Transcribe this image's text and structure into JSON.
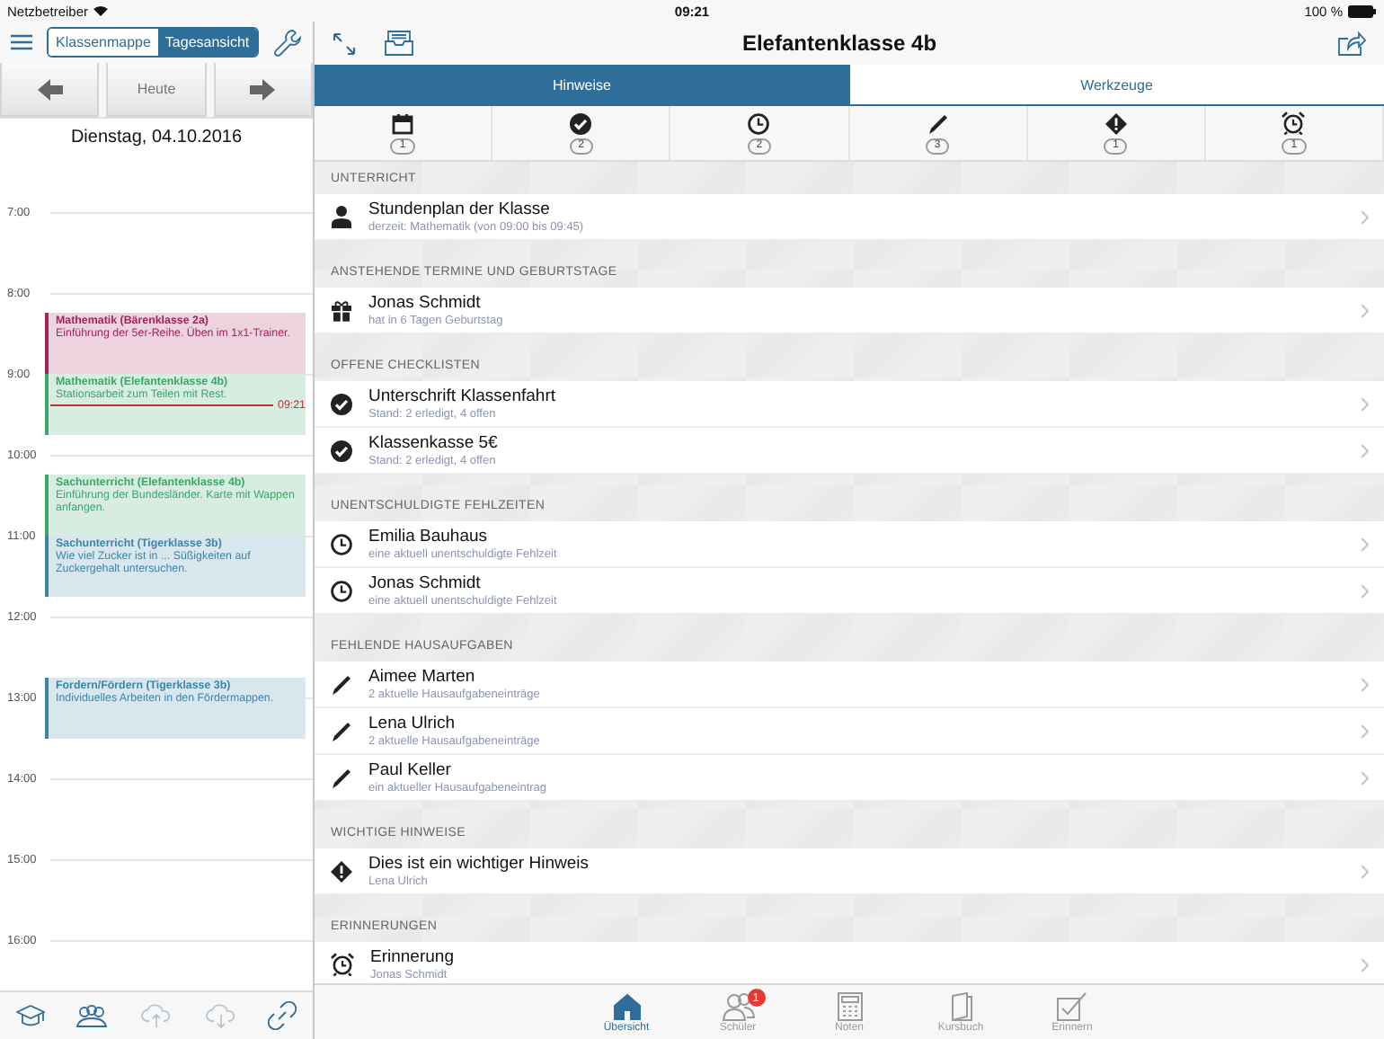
{
  "status_bar": {
    "carrier": "Netzbetreiber",
    "time": "09:21",
    "battery": "100 %"
  },
  "sidebar": {
    "segments": [
      {
        "label": "Klassenmappe",
        "selected": false
      },
      {
        "label": "Tagesansicht",
        "selected": true
      }
    ],
    "today_button": "Heute",
    "date": "Dienstag, 04.10.2016",
    "hours": [
      "7:00",
      "8:00",
      "9:00",
      "10:00",
      "11:00",
      "12:00",
      "13:00",
      "14:00",
      "15:00",
      "16:00"
    ],
    "now": "09:21",
    "events": [
      {
        "title": "Mathematik (Bärenklasse 2a)",
        "text": "Einführung der 5er-Reihe. Üben im 1x1-Trainer.",
        "color": "#a3245a"
      },
      {
        "title": "Mathematik (Elefantenklasse 4b)",
        "text": "Stationsarbeit zum Teilen mit Rest.",
        "color": "#3aa66a"
      },
      {
        "title": "Sachunterricht (Elefantenklasse 4b)",
        "text": "Einführung der Bundesländer. Karte mit Wappen anfangen.",
        "color": "#3aa66a"
      },
      {
        "title": "Sachunterricht (Tigerklasse 3b)",
        "text": "Wie viel Zucker ist in ... Süßigkeiten auf Zuckergehalt untersuchen.",
        "color": "#3a86a8"
      },
      {
        "title": "Fordern/Fördern (Tigerklasse 3b)",
        "text": "Individuelles Arbeiten in den Fördermappen.",
        "color": "#3a86a8"
      }
    ]
  },
  "header": {
    "title": "Elefantenklasse 4b"
  },
  "tabs": [
    {
      "label": "Hinweise",
      "selected": true
    },
    {
      "label": "Werkzeuge",
      "selected": false
    }
  ],
  "filters": [
    {
      "kind": "calendar",
      "count": "1"
    },
    {
      "kind": "check",
      "count": "2"
    },
    {
      "kind": "clock",
      "count": "2"
    },
    {
      "kind": "pen",
      "count": "3"
    },
    {
      "kind": "warning",
      "count": "1"
    },
    {
      "kind": "alarm",
      "count": "1"
    }
  ],
  "sections": [
    {
      "title": "UNTERRICHT",
      "kind": "person",
      "rows": [
        {
          "title": "Stundenplan der Klasse",
          "subtitle": "derzeit: Mathematik (von 09:00 bis 09:45)"
        }
      ]
    },
    {
      "title": "ANSTEHENDE TERMINE UND GEBURTSTAGE",
      "kind": "gift",
      "rows": [
        {
          "title": "Jonas Schmidt",
          "subtitle": "hat in 6 Tagen Geburtstag"
        }
      ]
    },
    {
      "title": "OFFENE CHECKLISTEN",
      "kind": "check",
      "rows": [
        {
          "title": "Unterschrift Klassenfahrt",
          "subtitle": "Stand: 2 erledigt, 4 offen"
        },
        {
          "title": "Klassenkasse 5€",
          "subtitle": "Stand: 2 erledigt, 4 offen"
        }
      ]
    },
    {
      "title": "UNENTSCHULDIGTE FEHLZEITEN",
      "kind": "clock",
      "rows": [
        {
          "title": "Emilia Bauhaus",
          "subtitle": "eine aktuell unentschuldigte Fehlzeit"
        },
        {
          "title": "Jonas Schmidt",
          "subtitle": "eine aktuell unentschuldigte Fehlzeit"
        }
      ]
    },
    {
      "title": "FEHLENDE HAUSAUFGABEN",
      "kind": "pen",
      "rows": [
        {
          "title": "Aimee Marten",
          "subtitle": "2 aktuelle Hausaufgabeneinträge"
        },
        {
          "title": "Lena Ulrich",
          "subtitle": "2 aktuelle Hausaufgabeneinträge"
        },
        {
          "title": "Paul Keller",
          "subtitle": "ein aktueller Hausaufgabeneintrag"
        }
      ]
    },
    {
      "title": "WICHTIGE HINWEISE",
      "kind": "warning",
      "rows": [
        {
          "title": "Dies ist ein wichtiger Hinweis",
          "subtitle": "Lena Ulrich"
        }
      ]
    },
    {
      "title": "ERINNERUNGEN",
      "kind": "alarm",
      "rows": [
        {
          "title": "Erinnerung",
          "subtitle": "Jonas Schmidt"
        }
      ]
    }
  ],
  "tab_bar": [
    {
      "kind": "home",
      "label": "Übersicht",
      "selected": true
    },
    {
      "kind": "people",
      "label": "Schüler",
      "selected": false,
      "badge": "1"
    },
    {
      "kind": "grid",
      "label": "Noten",
      "selected": false
    },
    {
      "kind": "book",
      "label": "Kursbuch",
      "selected": false
    },
    {
      "kind": "check",
      "label": "Erinnern",
      "selected": false
    }
  ]
}
